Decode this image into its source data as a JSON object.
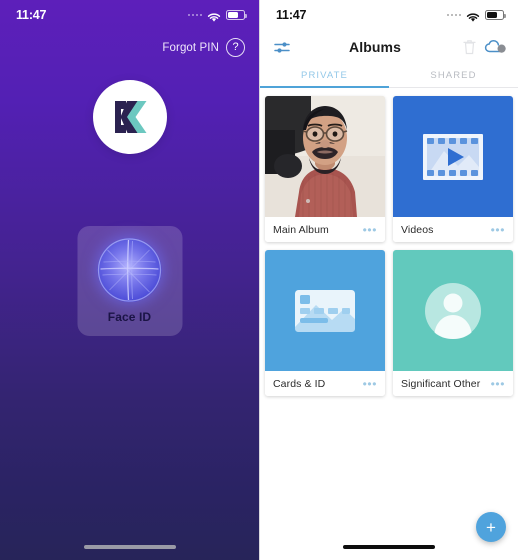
{
  "left_screen": {
    "status_bar": {
      "time": "11:47",
      "wifi_icon": "wifi-icon",
      "battery_icon": "battery-icon",
      "signal_icon": "signal-dots-icon"
    },
    "forgot_pin": {
      "label": "Forgot PIN",
      "help_icon": "question-mark-circle-icon"
    },
    "logo": {
      "name": "keepsafe-k-logo",
      "letter": "K"
    },
    "unlock": {
      "label": "Face ID",
      "icon": "face-id-scan-icon"
    },
    "home_indicator": "home-indicator",
    "colors": {
      "gradient_top": "#5d1fba",
      "gradient_bottom": "#272459",
      "button_bg": "rgba(255,255,255,0.17)",
      "label_color": "#1b1445"
    }
  },
  "right_screen": {
    "status_bar": {
      "time": "11:47",
      "wifi_icon": "wifi-icon",
      "battery_icon": "battery-icon",
      "signal_icon": "signal-dots-icon"
    },
    "app_bar": {
      "title": "Albums",
      "filter_icon": "sliders-filter-icon",
      "trash_icon": "trash-bin-icon",
      "cloud_icon": "cloud-sync-icon"
    },
    "tabs": [
      {
        "label": "PRIVATE",
        "active": true
      },
      {
        "label": "SHARED",
        "active": false
      }
    ],
    "albums": [
      {
        "name": "Main Album",
        "more": "•••",
        "thumb_type": "photo",
        "thumb_icon": "portrait-photo",
        "bg": "#e9e3dd"
      },
      {
        "name": "Videos",
        "more": "•••",
        "thumb_type": "icon",
        "thumb_icon": "film-strip-play-icon",
        "bg": "#2f6ed1"
      },
      {
        "name": "Cards & ID",
        "more": "•••",
        "thumb_type": "icon",
        "thumb_icon": "id-card-icon",
        "bg": "#4fa3dd"
      },
      {
        "name": "Significant Other",
        "more": "•••",
        "thumb_type": "icon",
        "thumb_icon": "person-avatar-icon",
        "bg": "#62c9bd"
      }
    ],
    "fab": {
      "label": "+",
      "icon": "plus-icon",
      "color": "#4fa3dd"
    },
    "home_indicator": "home-indicator",
    "colors": {
      "accent": "#4fa3d8",
      "tab_active": "#93c8e8",
      "tab_inactive": "#b9bcc2",
      "more_dots": "#9ec9e4"
    }
  }
}
